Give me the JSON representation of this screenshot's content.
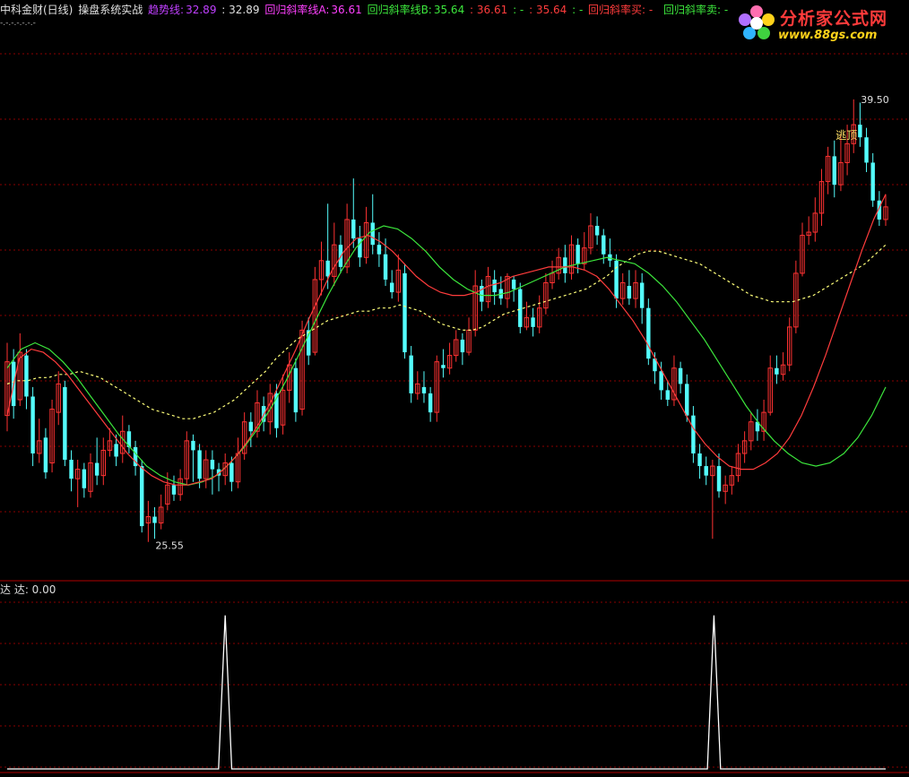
{
  "header": {
    "title": "中科金财(日线)",
    "indicator": "操盘系统实战",
    "trend_label": "趋势线:",
    "trend_value": "32.89",
    "trend_value2": ": 32.89",
    "regA_label": "回归斜率线A:",
    "regA_value": "36.61",
    "regB_label": "回归斜率线B:",
    "regB_value": "35.64",
    "v1": ": 36.61",
    "v2": ": -",
    "v3": ": 35.64",
    "v4": ": -",
    "buy_label": "回归斜率买: -",
    "sell_label": "回归斜率卖: -",
    "dots": "-.-.-.-.-.-.-"
  },
  "sub_header": {
    "label": "达 达: 0.00"
  },
  "logo": {
    "name": "分析家公式网",
    "url": "www.88gs.com"
  },
  "colors": {
    "up": "#ff3232",
    "down": "#54fcfc",
    "trend": "#ffff7a",
    "regA": "#ff3c3c",
    "regB": "#3ce63c",
    "purple": "#c040ff",
    "grid": "#8a0000"
  },
  "chart_data": [
    {
      "type": "candlestick",
      "title": "",
      "annotations": [
        {
          "text": "39.50",
          "kind": "high-label"
        },
        {
          "text": "25.55",
          "kind": "low-label"
        },
        {
          "text": "逃顶",
          "kind": "signal-text"
        }
      ],
      "ylim": [
        24.5,
        41.0
      ],
      "candles": [
        [
          29.5,
          31.2,
          31.8,
          29.0
        ],
        [
          31.2,
          29.8,
          31.6,
          29.4
        ],
        [
          30.0,
          31.5,
          32.1,
          29.8
        ],
        [
          31.4,
          30.1,
          31.6,
          29.7
        ],
        [
          30.1,
          28.3,
          30.4,
          27.9
        ],
        [
          28.3,
          28.7,
          29.4,
          28.0
        ],
        [
          28.8,
          27.7,
          29.1,
          27.5
        ],
        [
          28.0,
          29.7,
          30.0,
          27.7
        ],
        [
          29.6,
          30.5,
          30.9,
          29.2
        ],
        [
          30.4,
          28.1,
          30.6,
          27.9
        ],
        [
          28.1,
          27.5,
          28.4,
          27.1
        ],
        [
          27.5,
          27.8,
          28.1,
          26.6
        ],
        [
          27.8,
          27.2,
          28.0,
          26.9
        ],
        [
          27.1,
          28.0,
          28.3,
          26.9
        ],
        [
          28.0,
          27.6,
          28.8,
          27.3
        ],
        [
          27.6,
          28.4,
          28.8,
          27.3
        ],
        [
          28.4,
          28.7,
          29.1,
          28.2
        ],
        [
          28.6,
          28.2,
          28.9,
          27.9
        ],
        [
          28.3,
          29.0,
          29.5,
          28.0
        ],
        [
          29.0,
          28.5,
          29.2,
          28.3
        ],
        [
          28.5,
          27.9,
          28.7,
          27.6
        ],
        [
          27.9,
          26.0,
          28.1,
          25.8
        ],
        [
          26.1,
          26.3,
          26.8,
          25.5
        ],
        [
          26.3,
          26.1,
          26.6,
          25.6
        ],
        [
          26.1,
          26.6,
          27.0,
          25.9
        ],
        [
          26.7,
          27.3,
          27.7,
          26.5
        ],
        [
          27.3,
          27.0,
          27.6,
          26.8
        ],
        [
          27.0,
          27.5,
          27.8,
          26.8
        ],
        [
          27.5,
          28.7,
          29.0,
          27.3
        ],
        [
          28.7,
          28.4,
          28.9,
          27.4
        ],
        [
          28.4,
          27.5,
          28.6,
          27.2
        ],
        [
          27.5,
          28.1,
          28.4,
          27.2
        ],
        [
          28.1,
          27.8,
          28.4,
          27.0
        ],
        [
          27.8,
          27.6,
          28.0,
          27.1
        ],
        [
          27.6,
          28.0,
          28.3,
          27.3
        ],
        [
          28.0,
          27.4,
          28.2,
          27.1
        ],
        [
          27.4,
          28.3,
          28.8,
          27.2
        ],
        [
          28.3,
          29.3,
          29.6,
          28.1
        ],
        [
          29.3,
          29.0,
          29.6,
          28.5
        ],
        [
          29.0,
          29.9,
          30.3,
          28.8
        ],
        [
          29.8,
          29.3,
          30.1,
          29.0
        ],
        [
          29.3,
          30.2,
          30.5,
          28.9
        ],
        [
          30.2,
          29.1,
          30.5,
          28.8
        ],
        [
          29.2,
          30.3,
          30.8,
          28.9
        ],
        [
          30.3,
          31.1,
          31.5,
          29.9
        ],
        [
          31.0,
          29.6,
          31.3,
          29.3
        ],
        [
          29.7,
          32.2,
          32.5,
          29.5
        ],
        [
          32.2,
          31.4,
          32.6,
          31.1
        ],
        [
          31.5,
          33.8,
          34.2,
          31.4
        ],
        [
          33.8,
          34.4,
          35.0,
          33.3
        ],
        [
          34.4,
          33.9,
          36.2,
          33.5
        ],
        [
          33.9,
          34.9,
          35.6,
          33.6
        ],
        [
          34.9,
          34.2,
          35.2,
          34.0
        ],
        [
          34.2,
          35.7,
          36.2,
          34.0
        ],
        [
          35.7,
          35.1,
          37.0,
          34.8
        ],
        [
          35.1,
          34.5,
          35.5,
          34.2
        ],
        [
          34.5,
          35.6,
          36.1,
          34.3
        ],
        [
          35.6,
          34.9,
          36.5,
          34.6
        ],
        [
          34.9,
          34.6,
          35.3,
          34.2
        ],
        [
          34.6,
          33.8,
          35.1,
          33.6
        ],
        [
          33.7,
          33.4,
          34.1,
          33.2
        ],
        [
          33.4,
          34.1,
          34.6,
          33.1
        ],
        [
          34.0,
          31.5,
          34.3,
          31.3
        ],
        [
          31.4,
          30.2,
          31.7,
          29.9
        ],
        [
          30.2,
          30.5,
          30.9,
          30.0
        ],
        [
          30.4,
          30.2,
          30.9,
          29.9
        ],
        [
          30.2,
          29.6,
          30.4,
          29.3
        ],
        [
          29.6,
          31.2,
          31.4,
          29.3
        ],
        [
          31.1,
          31.0,
          31.6,
          30.7
        ],
        [
          31.0,
          31.4,
          31.8,
          30.8
        ],
        [
          31.4,
          31.9,
          32.2,
          31.2
        ],
        [
          31.9,
          31.5,
          32.1,
          31.1
        ],
        [
          31.5,
          32.2,
          32.6,
          31.4
        ],
        [
          32.2,
          33.6,
          34.1,
          32.0
        ],
        [
          33.6,
          33.1,
          33.8,
          32.8
        ],
        [
          33.1,
          33.9,
          34.2,
          32.9
        ],
        [
          33.8,
          33.4,
          34.1,
          33.0
        ],
        [
          33.5,
          33.2,
          33.9,
          33.0
        ],
        [
          33.2,
          33.9,
          34.0,
          32.9
        ],
        [
          33.8,
          33.5,
          33.9,
          33.1
        ],
        [
          33.5,
          32.3,
          33.7,
          32.1
        ],
        [
          32.3,
          32.6,
          33.1,
          32.2
        ],
        [
          32.6,
          32.3,
          32.9,
          32.0
        ],
        [
          32.3,
          32.9,
          33.3,
          32.1
        ],
        [
          32.9,
          33.7,
          34.0,
          32.7
        ],
        [
          33.7,
          34.0,
          34.4,
          33.5
        ],
        [
          34.0,
          34.5,
          34.8,
          33.8
        ],
        [
          34.5,
          34.0,
          34.9,
          33.7
        ],
        [
          34.0,
          34.9,
          35.2,
          33.8
        ],
        [
          34.9,
          34.3,
          35.1,
          34.0
        ],
        [
          34.3,
          34.8,
          35.3,
          34.1
        ],
        [
          34.8,
          35.5,
          35.9,
          34.6
        ],
        [
          35.5,
          35.2,
          35.8,
          34.9
        ],
        [
          35.2,
          34.6,
          35.4,
          34.3
        ],
        [
          34.6,
          34.4,
          35.1,
          34.2
        ],
        [
          34.4,
          33.2,
          34.6,
          32.9
        ],
        [
          33.2,
          33.7,
          34.0,
          33.0
        ],
        [
          33.6,
          33.2,
          34.1,
          33.0
        ],
        [
          33.2,
          33.7,
          34.1,
          32.9
        ],
        [
          33.7,
          32.9,
          34.0,
          32.4
        ],
        [
          32.9,
          31.3,
          33.2,
          31.1
        ],
        [
          31.3,
          30.9,
          31.5,
          30.5
        ],
        [
          30.9,
          30.3,
          31.2,
          30.0
        ],
        [
          30.3,
          30.0,
          30.6,
          29.8
        ],
        [
          30.0,
          31.0,
          31.4,
          29.8
        ],
        [
          31.0,
          30.5,
          31.2,
          30.2
        ],
        [
          30.5,
          29.5,
          30.8,
          29.3
        ],
        [
          29.5,
          28.3,
          29.8,
          28.0
        ],
        [
          28.3,
          27.9,
          28.6,
          27.5
        ],
        [
          27.9,
          27.6,
          28.2,
          27.3
        ],
        [
          27.6,
          27.9,
          28.1,
          25.6
        ],
        [
          27.9,
          27.1,
          28.3,
          26.9
        ],
        [
          27.1,
          27.3,
          27.6,
          26.7
        ],
        [
          27.3,
          27.6,
          27.9,
          27.0
        ],
        [
          27.6,
          28.3,
          28.6,
          27.4
        ],
        [
          28.3,
          28.7,
          29.0,
          28.0
        ],
        [
          28.7,
          29.3,
          29.6,
          28.4
        ],
        [
          29.3,
          29.0,
          29.7,
          28.7
        ],
        [
          29.0,
          29.6,
          30.0,
          28.7
        ],
        [
          29.6,
          31.0,
          31.4,
          29.5
        ],
        [
          31.0,
          30.8,
          31.4,
          30.5
        ],
        [
          30.8,
          31.1,
          31.5,
          30.6
        ],
        [
          31.1,
          32.3,
          32.6,
          30.9
        ],
        [
          32.3,
          34.0,
          34.4,
          32.1
        ],
        [
          34.0,
          35.2,
          35.6,
          33.9
        ],
        [
          35.2,
          35.3,
          35.8,
          34.9
        ],
        [
          35.3,
          35.9,
          36.4,
          35.0
        ],
        [
          35.9,
          36.9,
          37.3,
          35.5
        ],
        [
          36.9,
          37.7,
          38.0,
          36.5
        ],
        [
          37.7,
          36.8,
          38.2,
          36.4
        ],
        [
          36.8,
          37.5,
          38.4,
          36.6
        ],
        [
          37.5,
          38.1,
          38.7,
          37.1
        ],
        [
          38.1,
          38.7,
          39.5,
          37.8
        ],
        [
          38.7,
          38.3,
          39.4,
          38.0
        ],
        [
          38.3,
          37.5,
          38.6,
          37.2
        ],
        [
          37.5,
          36.3,
          37.8,
          36.1
        ],
        [
          36.3,
          35.7,
          36.6,
          35.5
        ],
        [
          35.7,
          36.1,
          36.5,
          35.5
        ]
      ],
      "trend_line": [
        30.5,
        30.6,
        30.6,
        30.7,
        30.7,
        30.8,
        30.8,
        30.9,
        30.8,
        30.7,
        30.5,
        30.3,
        30.1,
        29.9,
        29.7,
        29.6,
        29.5,
        29.4,
        29.4,
        29.5,
        29.6,
        29.8,
        30.0,
        30.3,
        30.6,
        30.9,
        31.3,
        31.6,
        31.9,
        32.1,
        32.3,
        32.5,
        32.6,
        32.7,
        32.8,
        32.8,
        32.9,
        32.9,
        33.0,
        32.9,
        32.8,
        32.6,
        32.4,
        32.3,
        32.2,
        32.2,
        32.3,
        32.5,
        32.7,
        32.8,
        32.9,
        33.0,
        33.1,
        33.2,
        33.3,
        33.4,
        33.5,
        33.7,
        33.9,
        34.2,
        34.4,
        34.6,
        34.7,
        34.7,
        34.6,
        34.5,
        34.4,
        34.3,
        34.1,
        33.9,
        33.7,
        33.5,
        33.3,
        33.2,
        33.1,
        33.1,
        33.1,
        33.2,
        33.3,
        33.5,
        33.7,
        33.9,
        34.1,
        34.3,
        34.6,
        34.9
      ],
      "regA": [
        29.5,
        31.3,
        31.6,
        31.5,
        31.2,
        30.8,
        30.3,
        29.8,
        29.3,
        28.8,
        28.3,
        27.9,
        27.6,
        27.4,
        27.3,
        27.3,
        27.4,
        27.5,
        27.8,
        28.2,
        28.7,
        29.3,
        30.0,
        30.8,
        31.6,
        32.5,
        33.3,
        34.1,
        34.7,
        35.1,
        35.2,
        35.0,
        34.7,
        34.3,
        33.9,
        33.6,
        33.4,
        33.3,
        33.3,
        33.4,
        33.6,
        33.7,
        33.9,
        34.0,
        34.1,
        34.2,
        34.2,
        34.2,
        34.1,
        33.9,
        33.5,
        33.0,
        32.5,
        31.9,
        31.2,
        30.5,
        29.8,
        29.1,
        28.6,
        28.2,
        27.9,
        27.8,
        27.8,
        28.0,
        28.3,
        28.8,
        29.5,
        30.4,
        31.4,
        32.5,
        33.6,
        34.7,
        35.7,
        36.5
      ],
      "regB": [
        31.0,
        31.6,
        31.8,
        31.6,
        31.2,
        30.7,
        30.1,
        29.5,
        28.9,
        28.4,
        27.9,
        27.6,
        27.4,
        27.3,
        27.4,
        27.6,
        28.0,
        28.5,
        29.1,
        29.8,
        30.6,
        31.5,
        32.4,
        33.3,
        34.1,
        34.8,
        35.3,
        35.5,
        35.4,
        35.1,
        34.7,
        34.2,
        33.8,
        33.5,
        33.3,
        33.3,
        33.4,
        33.6,
        33.8,
        34.0,
        34.2,
        34.3,
        34.4,
        34.5,
        34.4,
        34.3,
        34.0,
        33.6,
        33.1,
        32.5,
        31.9,
        31.2,
        30.5,
        29.8,
        29.2,
        28.7,
        28.3,
        28.0,
        27.9,
        28.0,
        28.3,
        28.8,
        29.5,
        30.4
      ]
    },
    {
      "type": "line",
      "title": "",
      "series": [
        {
          "values": [
            0,
            0,
            0,
            0,
            0,
            0,
            0,
            0,
            0,
            0,
            0,
            0,
            0,
            0,
            0,
            0,
            0,
            0,
            0,
            0,
            0,
            0,
            0,
            0,
            0,
            0,
            0,
            0,
            0,
            0,
            0,
            0,
            0,
            1,
            0,
            0,
            0,
            0,
            0,
            0,
            0,
            0,
            0,
            0,
            0,
            0,
            0,
            0,
            0,
            0,
            0,
            0,
            0,
            0,
            0,
            0,
            0,
            0,
            0,
            0,
            0,
            0,
            0,
            0,
            0,
            0,
            0,
            0,
            0,
            0,
            0,
            0,
            0,
            0,
            0,
            0,
            0,
            0,
            0,
            0,
            0,
            0,
            0,
            0,
            0,
            0,
            0,
            0,
            0,
            0,
            0,
            0,
            0,
            0,
            0,
            0,
            0,
            0,
            0,
            0,
            0,
            0,
            0,
            0,
            0,
            0,
            0,
            1,
            0,
            0,
            0,
            0,
            0,
            0,
            0,
            0,
            0,
            0,
            0,
            0,
            0,
            0,
            0,
            0,
            0,
            0,
            0,
            0,
            0,
            0,
            0,
            0,
            0,
            0
          ]
        }
      ],
      "ylim": [
        0,
        1.05
      ]
    }
  ]
}
